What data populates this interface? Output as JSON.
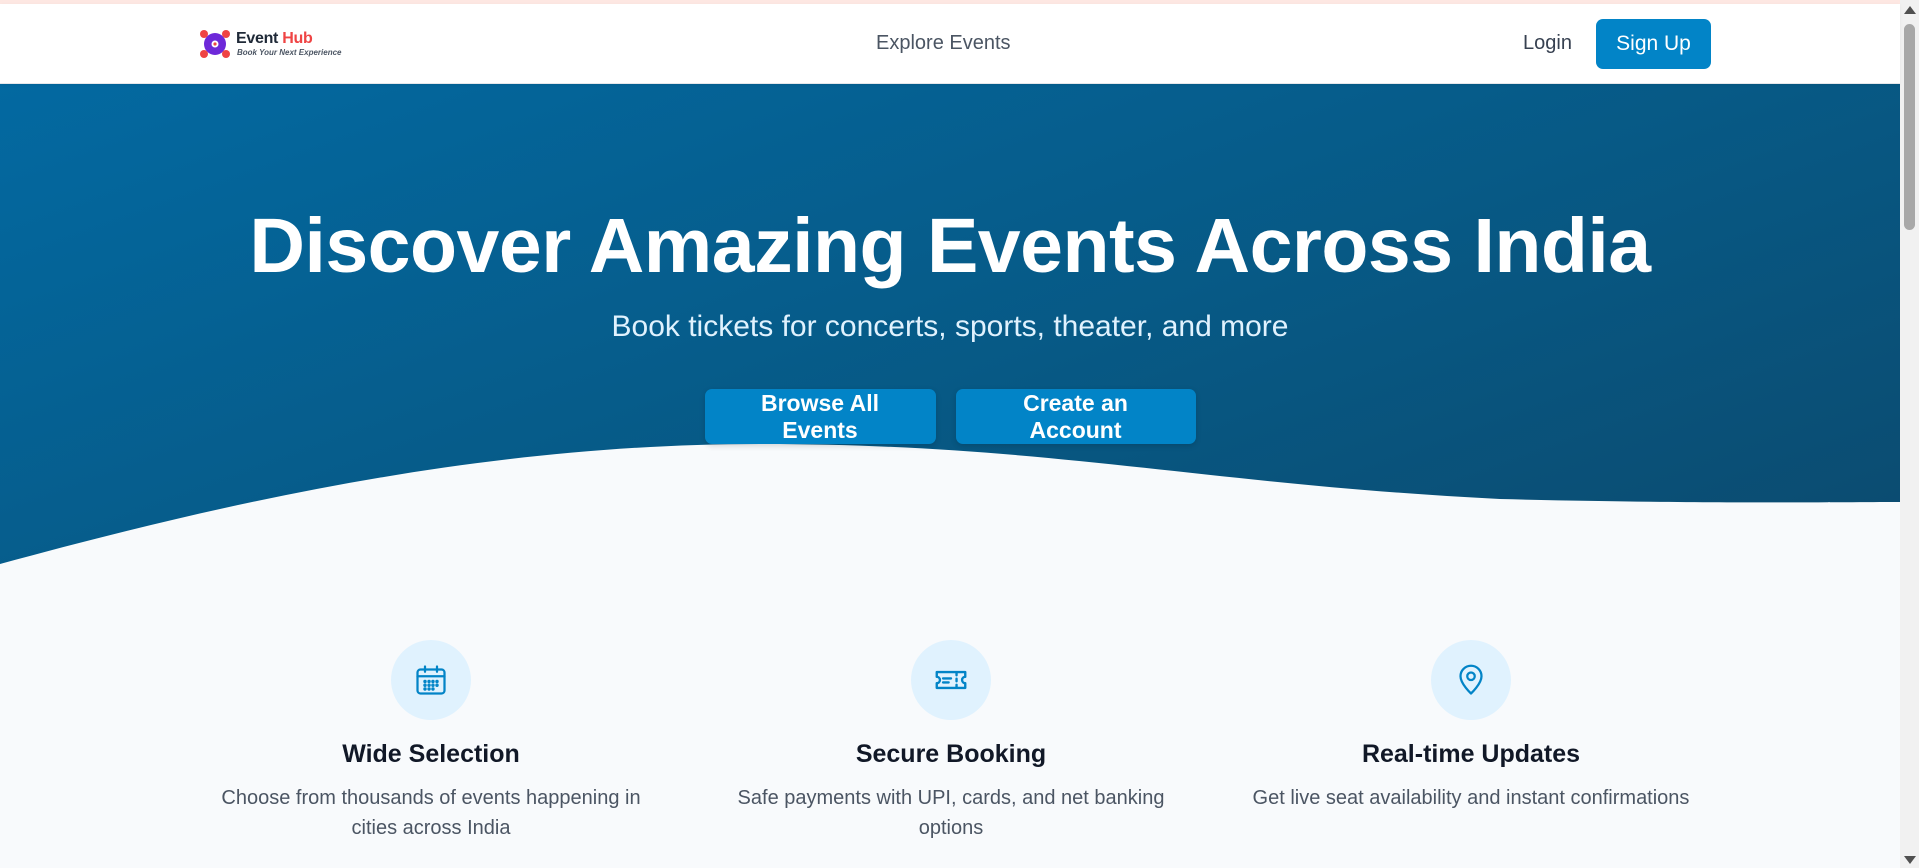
{
  "header": {
    "logo_word1": "Event",
    "logo_word2": "Hub",
    "logo_tagline": "Book Your Next Experience",
    "nav_explore": "Explore Events",
    "login": "Login",
    "signup": "Sign Up"
  },
  "hero": {
    "title": "Discover Amazing Events Across India",
    "subtitle": "Book tickets for concerts, sports, theater, and more",
    "browse_button": "Browse All Events",
    "create_button": "Create an Account"
  },
  "features": [
    {
      "icon": "calendar-icon",
      "title": "Wide Selection",
      "description": "Choose from thousands of events happening in cities across India"
    },
    {
      "icon": "ticket-icon",
      "title": "Secure Booking",
      "description": "Safe payments with UPI, cards, and net banking options"
    },
    {
      "icon": "map-pin-icon",
      "title": "Real-time Updates",
      "description": "Get live seat availability and instant confirmations"
    }
  ],
  "colors": {
    "primary": "#0284c7",
    "hero_bg": "#075985",
    "brand_red": "#ef4444",
    "brand_purple": "#6d28d9",
    "feature_icon_bg": "#e0f2fe"
  }
}
